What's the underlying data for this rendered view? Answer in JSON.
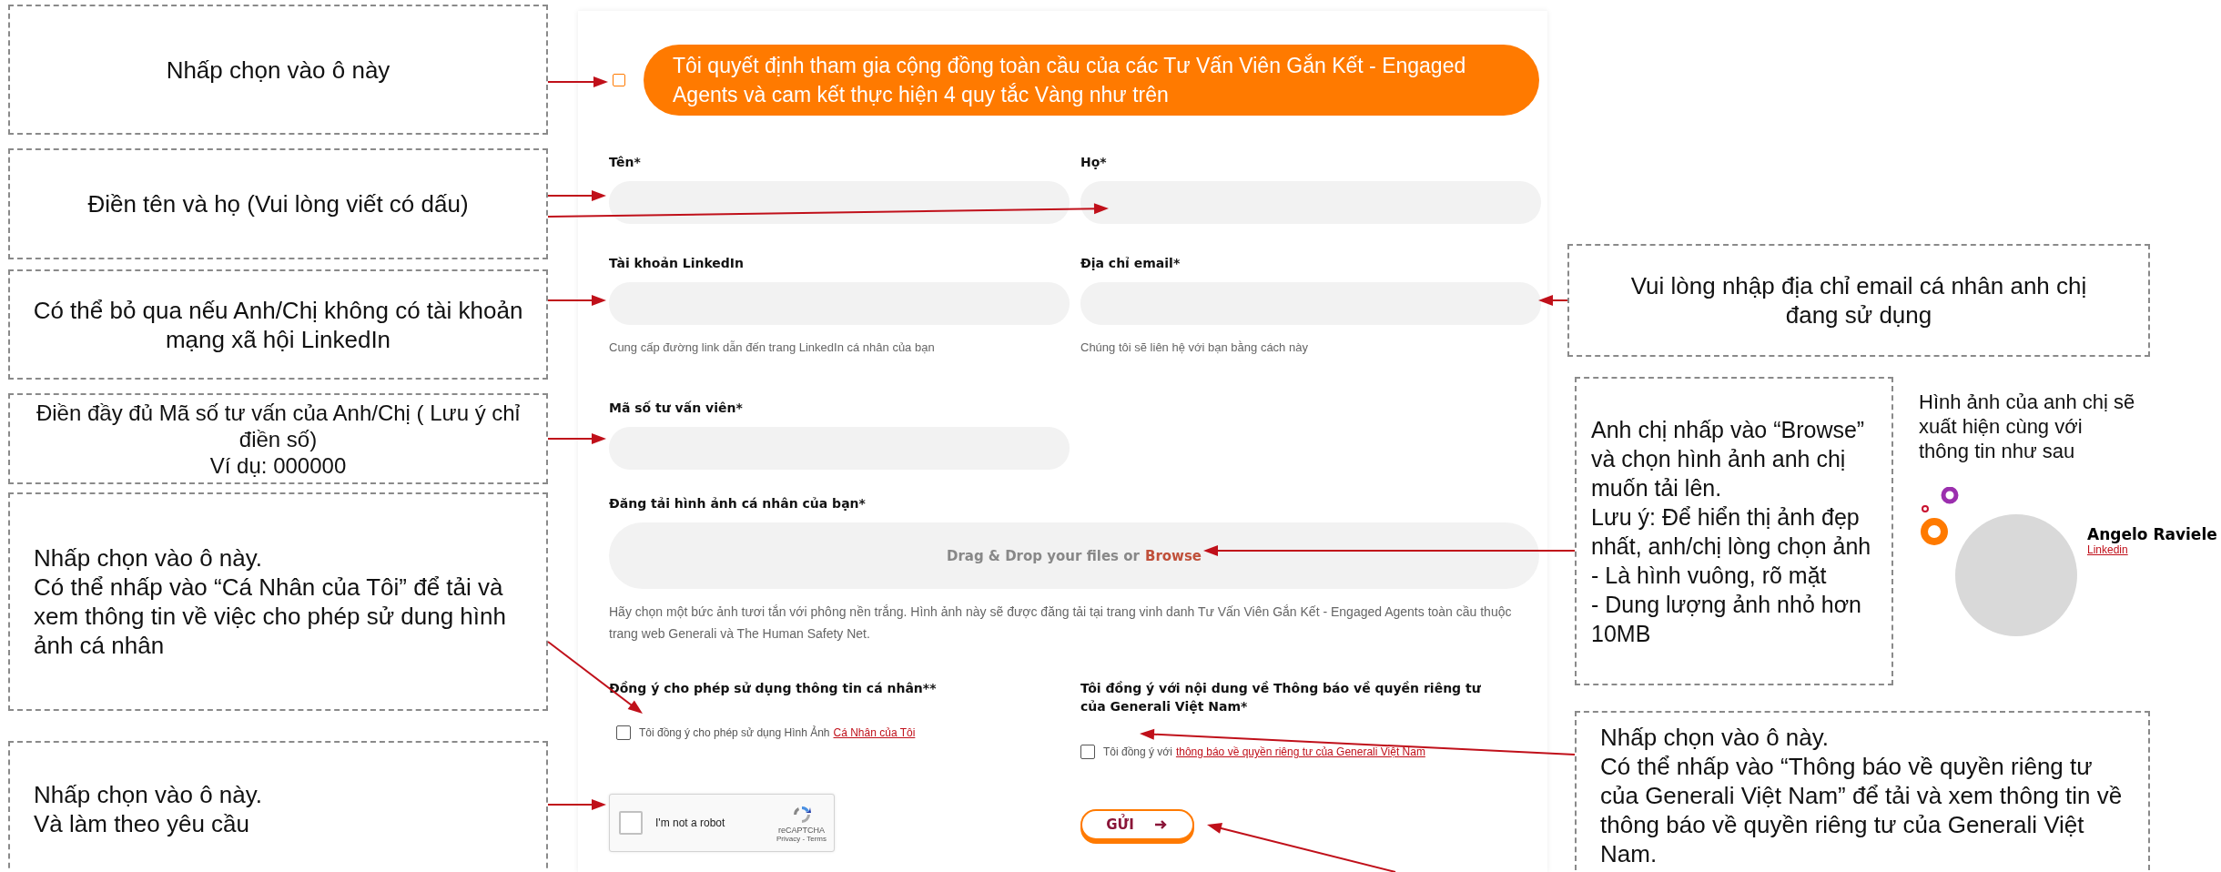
{
  "callouts": [
    {
      "text": "Nhấp chọn vào ô này"
    },
    {
      "text": "Điền tên và họ (Vui lòng viết có dấu)"
    },
    {
      "text": "Có thể bỏ qua nếu Anh/Chị không có tài khoản mạng xã hội LinkedIn"
    },
    {
      "text": "Điền đầy đủ Mã số tư vấn của Anh/Chị ( Lưu ý chỉ điền số)\nVí dụ: 000000"
    },
    {
      "text": "Nhấp chọn vào ô này.\nCó thể nhấp vào “Cá Nhân của Tôi” để tải và xem thông tin về việc cho phép sử dung hình ảnh cá nhân"
    },
    {
      "text": "Nhấp chọn vào ô này.\nVà làm theo yêu cầu"
    },
    {
      "text": "Vui lòng nhập địa chỉ email cá nhân anh chị đang sử dụng"
    },
    {
      "text": "Anh chị nhấp vào “Browse” và chọn hình ảnh anh chị muốn tải lên.\nLưu ý: Để hiển thị ảnh đẹp nhất, anh/chị lòng chọn ảnh\n- Là hình vuông, rõ mặt\n- Dung lượng ảnh nhỏ hơn 10MB"
    },
    {
      "text": "Nhấp chọn vào ô này.\nCó thể nhấp vào “Thông báo về quyền riêng tư của Generali Việt Nam” để tải và xem thông tin về thông báo về quyền riêng tư của Generali Việt Nam."
    }
  ],
  "form": {
    "agreement": {
      "text": "Tôi quyết định tham gia cộng đồng toàn cầu của các Tư Vấn Viên Gắn Kết - Engaged Agents và cam kết thực hiện 4 quy tắc Vàng như trên",
      "checked": false
    },
    "field_rows": [
      {
        "fields": [
          {
            "label": "Tên*"
          },
          {
            "label": "Họ*"
          }
        ]
      },
      {
        "fields": [
          {
            "label": "Tài khoản LinkedIn",
            "helper": "Cung cấp đường link dẫn đến trang LinkedIn cá nhân của bạn"
          },
          {
            "label": "Địa chỉ email*",
            "helper": "Chúng tôi sẽ liên hệ với bạn bằng cách này"
          }
        ]
      },
      {
        "fields": [
          {
            "label": "Mã số tư vấn viên*"
          }
        ]
      }
    ],
    "upload": {
      "label": "Đăng tải hình ảnh cá nhân của bạn*",
      "drop_text": "Drag & Drop your files or",
      "browse": "Browse",
      "helper": "Hãy chọn một bức ảnh tươi tắn với phông nền trắng. Hình ảnh này sẽ được đăng tải tại trang vinh danh Tư Vấn Viên Gắn Kết - Engaged Agents toàn cầu thuộc trang web Generali và The Human Safety Net."
    },
    "consents": [
      {
        "label": "Đồng ý cho phép sử dụng thông tin cá nhân**",
        "text": "Tôi đồng ý cho phép sử dụng Hình Ảnh",
        "link": "Cá Nhân của Tôi",
        "checked": false
      },
      {
        "label": "Tôi đồng ý với nội dung về Thông báo về quyền riêng tư của Generali Việt Nam*",
        "text": "Tôi đồng ý với",
        "link": "thông báo về quyền riêng tư của Generali Việt Nam",
        "checked": false
      }
    ],
    "captcha": {
      "label": "I'm not a robot",
      "brand": "reCAPTCHA",
      "links": "Privacy - Terms",
      "checked": false
    },
    "submit": {
      "label": "GỬI"
    }
  },
  "preview": {
    "caption": "Hình ảnh của anh chị sẽ xuất hiện cùng với thông tin như sau",
    "name": "Angelo Raviele",
    "link": "Linkedin"
  }
}
